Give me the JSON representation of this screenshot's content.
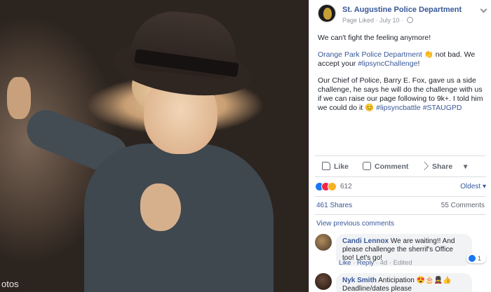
{
  "photo": {
    "caption_text": "otos"
  },
  "post": {
    "page_name": "St. Augustine Police Department",
    "page_liked": "Page Liked",
    "date": "July 10",
    "line1": "We can't fight the feeling anymore!",
    "mention": "Orange Park Police Department",
    "mention_suffix": "not bad. We accept your",
    "hashtag1": "#lipsyncChallenge",
    "hashtag1_suffix": "!",
    "paragraph3": "Our Chief of Police, Barry E. Fox, gave us a side challenge, he says he will do the challenge with us if we can raise our page following to 9k+. I told him we could do it",
    "hashtag2": "#lipsyncbattle",
    "hashtag3": "#STAUGPD"
  },
  "actions": {
    "like": "Like",
    "comment": "Comment",
    "share": "Share"
  },
  "reactions": {
    "count": "612",
    "sort": "Oldest"
  },
  "stats": {
    "shares": "461 Shares",
    "comments": "55 Comments"
  },
  "view_previous": "View previous comments",
  "comments": [
    {
      "name": "Candi Lennox",
      "text": "We are waiting!! And please challenge the sherrif's Office too! Let's go!",
      "like": "Like",
      "reply": "Reply",
      "age": "4d",
      "edited": "Edited",
      "reaction_count": "1"
    },
    {
      "name": "Nyk Smith",
      "text": "Anticipation",
      "text2": "Deadline/dates please"
    }
  ]
}
